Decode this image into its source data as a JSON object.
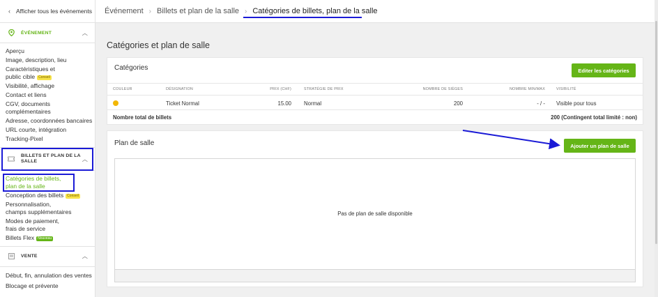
{
  "sidebar": {
    "back_label": "Afficher tous les événements",
    "section_event": {
      "title": "ÉVÉNEMENT",
      "items": [
        {
          "label": "Aperçu"
        },
        {
          "label": "Image, description, lieu"
        },
        {
          "label": "Caractéristiques et"
        },
        {
          "label": "public cible",
          "badge": "Conseil"
        },
        {
          "label": "Visibilité, affichage"
        },
        {
          "label": "Contact et liens"
        },
        {
          "label": "CGV, documents complémentaires"
        },
        {
          "label": "Adresse, coordonnées bancaires"
        },
        {
          "label": "URL courte, intégration"
        },
        {
          "label": "Tracking-Pixel"
        }
      ]
    },
    "section_tickets": {
      "title_line1": "BILLETS ET PLAN DE LA",
      "title_line2": "SALLE",
      "items": [
        {
          "label": "Catégories de billets,"
        },
        {
          "label": "plan de la salle"
        },
        {
          "label": "Conception des billets",
          "badge": "Conseil"
        },
        {
          "label": "Personnalisation,"
        },
        {
          "label": "champs supplémentaires"
        },
        {
          "label": "Modes de paiement,"
        },
        {
          "label": "frais de service"
        },
        {
          "label": "Billets Flex",
          "badge": "Nouveau"
        }
      ]
    },
    "section_sale": {
      "title": "VENTE",
      "items": [
        {
          "label": "Début, fin, annulation des ventes"
        },
        {
          "label": "Blocage et prévente"
        }
      ]
    }
  },
  "breadcrumb": {
    "items": [
      "Événement",
      "Billets et plan de la salle",
      "Catégories de billets, plan de la salle"
    ]
  },
  "page_title": "Catégories et plan de salle",
  "categories": {
    "title": "Catégories",
    "edit_button": "Editer les catégories",
    "columns": [
      "COULEUR",
      "DÉSIGNATION",
      "PRIX (CHF)",
      "STRATÉGIE DE PRIX",
      "NOMBRE DE SIÈGES",
      "NOMBRE MIN/MAX",
      "VISIBILITÉ"
    ],
    "rows": [
      {
        "color": "#f2b705",
        "name": "Ticket Normal",
        "price": "15.00",
        "strategy": "Normal",
        "seats": "200",
        "minmax": "- / -",
        "visibility": "Visible pour tous"
      }
    ],
    "total_label": "Nombre total de billets",
    "total_value": "200 (Contingent total limité : non)"
  },
  "seating": {
    "title": "Plan de salle",
    "add_button": "Ajouter un plan de salle",
    "empty_text": "Pas de plan de salle disponible"
  },
  "colors": {
    "accent": "#65b517",
    "annotation": "#1a1ad6"
  }
}
